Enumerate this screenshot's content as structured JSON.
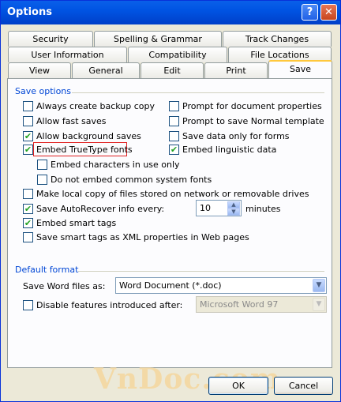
{
  "window": {
    "title": "Options",
    "help_label": "?",
    "close_label": "✕"
  },
  "tabs": {
    "row1": [
      {
        "label": "Security"
      },
      {
        "label": "Spelling & Grammar"
      },
      {
        "label": "Track Changes"
      }
    ],
    "row2": [
      {
        "label": "User Information"
      },
      {
        "label": "Compatibility"
      },
      {
        "label": "File Locations"
      }
    ],
    "row3": [
      {
        "label": "View"
      },
      {
        "label": "General"
      },
      {
        "label": "Edit"
      },
      {
        "label": "Print"
      },
      {
        "label": "Save",
        "active": true
      }
    ]
  },
  "save_options": {
    "header": "Save options",
    "left": [
      {
        "label": "Always create backup copy",
        "checked": false
      },
      {
        "label": "Allow fast saves",
        "checked": false
      },
      {
        "label": "Allow background saves",
        "checked": true
      },
      {
        "label": "Embed TrueType fonts",
        "checked": true
      },
      {
        "label": "Embed characters in use only",
        "checked": false
      },
      {
        "label": "Do not embed common system fonts",
        "checked": false
      }
    ],
    "right": [
      {
        "label": "Prompt for document properties",
        "checked": false
      },
      {
        "label": "Prompt to save Normal template",
        "checked": false
      },
      {
        "label": "Save data only for forms",
        "checked": false
      },
      {
        "label": "Embed linguistic data",
        "checked": true
      }
    ],
    "bottom": [
      {
        "label": "Make local copy of files stored on network or removable drives",
        "checked": false
      },
      {
        "label": "Save AutoRecover info every:",
        "checked": true
      },
      {
        "label": "Embed smart tags",
        "checked": true
      },
      {
        "label": "Save smart tags as XML properties in Web pages",
        "checked": false
      }
    ],
    "autorecover_value": "10",
    "autorecover_unit": "minutes"
  },
  "default_format": {
    "header": "Default format",
    "save_as_label": "Save Word files as:",
    "save_as_value": "Word Document (*.doc)",
    "disable_label": "Disable features introduced after:",
    "disable_checked": false,
    "disable_value": "Microsoft Word 97"
  },
  "buttons": {
    "ok": "OK",
    "cancel": "Cancel"
  },
  "watermark": "VnDoc.com",
  "colors": {
    "title_bar": "#0054e3",
    "section_header": "#0046d5",
    "highlight": "#e02020",
    "check": "#21a121"
  }
}
